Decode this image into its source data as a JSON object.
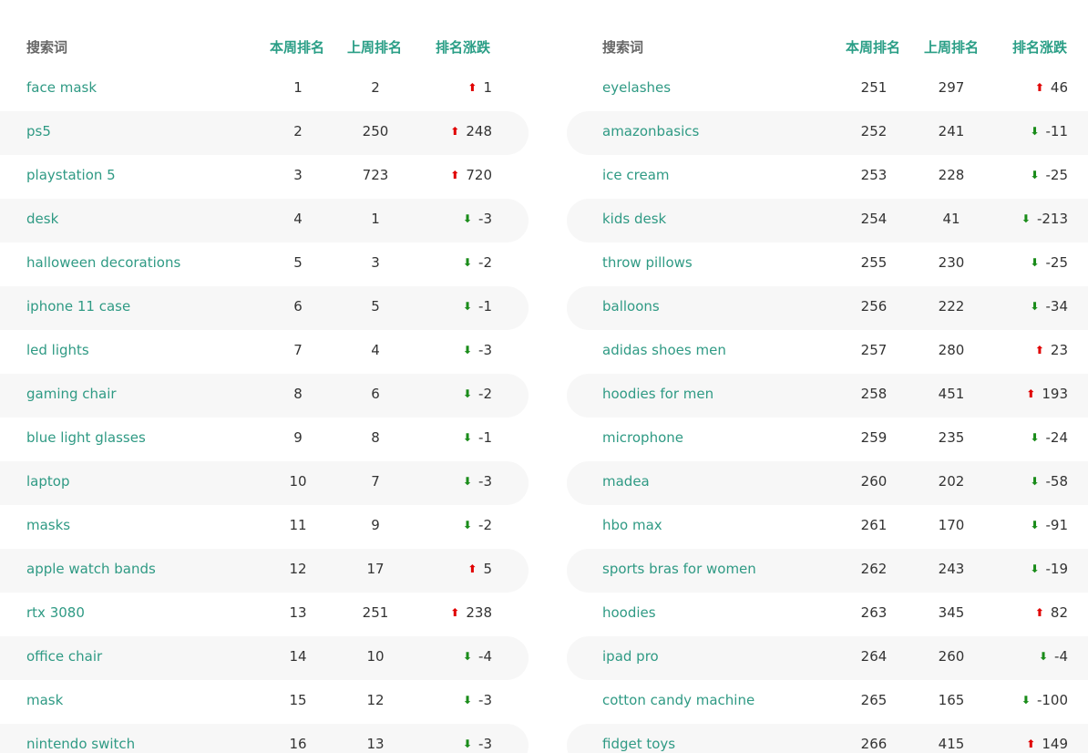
{
  "headers": {
    "keyword": "搜索词",
    "this_week": "本周排名",
    "last_week": "上周排名",
    "change": "排名涨跌"
  },
  "colors": {
    "keyword_text": "#2f9a84",
    "header_accent": "#2a9e86",
    "up_arrow": "#e00000",
    "down_arrow": "#1a8c1a",
    "row_stripe": "#f7f7f7"
  },
  "left_table": [
    {
      "keyword": "face mask",
      "this_week": "1",
      "last_week": "2",
      "direction": "up",
      "change": "1"
    },
    {
      "keyword": "ps5",
      "this_week": "2",
      "last_week": "250",
      "direction": "up",
      "change": "248"
    },
    {
      "keyword": "playstation 5",
      "this_week": "3",
      "last_week": "723",
      "direction": "up",
      "change": "720"
    },
    {
      "keyword": "desk",
      "this_week": "4",
      "last_week": "1",
      "direction": "down",
      "change": "-3"
    },
    {
      "keyword": "halloween decorations",
      "this_week": "5",
      "last_week": "3",
      "direction": "down",
      "change": "-2"
    },
    {
      "keyword": "iphone 11 case",
      "this_week": "6",
      "last_week": "5",
      "direction": "down",
      "change": "-1"
    },
    {
      "keyword": "led lights",
      "this_week": "7",
      "last_week": "4",
      "direction": "down",
      "change": "-3"
    },
    {
      "keyword": "gaming chair",
      "this_week": "8",
      "last_week": "6",
      "direction": "down",
      "change": "-2"
    },
    {
      "keyword": "blue light glasses",
      "this_week": "9",
      "last_week": "8",
      "direction": "down",
      "change": "-1"
    },
    {
      "keyword": "laptop",
      "this_week": "10",
      "last_week": "7",
      "direction": "down",
      "change": "-3"
    },
    {
      "keyword": "masks",
      "this_week": "11",
      "last_week": "9",
      "direction": "down",
      "change": "-2"
    },
    {
      "keyword": "apple watch bands",
      "this_week": "12",
      "last_week": "17",
      "direction": "up",
      "change": "5"
    },
    {
      "keyword": "rtx 3080",
      "this_week": "13",
      "last_week": "251",
      "direction": "up",
      "change": "238"
    },
    {
      "keyword": "office chair",
      "this_week": "14",
      "last_week": "10",
      "direction": "down",
      "change": "-4"
    },
    {
      "keyword": "mask",
      "this_week": "15",
      "last_week": "12",
      "direction": "down",
      "change": "-3"
    },
    {
      "keyword": "nintendo switch",
      "this_week": "16",
      "last_week": "13",
      "direction": "down",
      "change": "-3"
    }
  ],
  "right_table": [
    {
      "keyword": "eyelashes",
      "this_week": "251",
      "last_week": "297",
      "direction": "up",
      "change": "46"
    },
    {
      "keyword": "amazonbasics",
      "this_week": "252",
      "last_week": "241",
      "direction": "down",
      "change": "-11"
    },
    {
      "keyword": "ice cream",
      "this_week": "253",
      "last_week": "228",
      "direction": "down",
      "change": "-25"
    },
    {
      "keyword": "kids desk",
      "this_week": "254",
      "last_week": "41",
      "direction": "down",
      "change": "-213"
    },
    {
      "keyword": "throw pillows",
      "this_week": "255",
      "last_week": "230",
      "direction": "down",
      "change": "-25"
    },
    {
      "keyword": "balloons",
      "this_week": "256",
      "last_week": "222",
      "direction": "down",
      "change": "-34"
    },
    {
      "keyword": "adidas shoes men",
      "this_week": "257",
      "last_week": "280",
      "direction": "up",
      "change": "23"
    },
    {
      "keyword": "hoodies for men",
      "this_week": "258",
      "last_week": "451",
      "direction": "up",
      "change": "193"
    },
    {
      "keyword": "microphone",
      "this_week": "259",
      "last_week": "235",
      "direction": "down",
      "change": "-24"
    },
    {
      "keyword": "madea",
      "this_week": "260",
      "last_week": "202",
      "direction": "down",
      "change": "-58"
    },
    {
      "keyword": "hbo max",
      "this_week": "261",
      "last_week": "170",
      "direction": "down",
      "change": "-91"
    },
    {
      "keyword": "sports bras for women",
      "this_week": "262",
      "last_week": "243",
      "direction": "down",
      "change": "-19"
    },
    {
      "keyword": "hoodies",
      "this_week": "263",
      "last_week": "345",
      "direction": "up",
      "change": "82"
    },
    {
      "keyword": "ipad pro",
      "this_week": "264",
      "last_week": "260",
      "direction": "down",
      "change": "-4"
    },
    {
      "keyword": "cotton candy machine",
      "this_week": "265",
      "last_week": "165",
      "direction": "down",
      "change": "-100"
    },
    {
      "keyword": "fidget toys",
      "this_week": "266",
      "last_week": "415",
      "direction": "up",
      "change": "149"
    }
  ]
}
